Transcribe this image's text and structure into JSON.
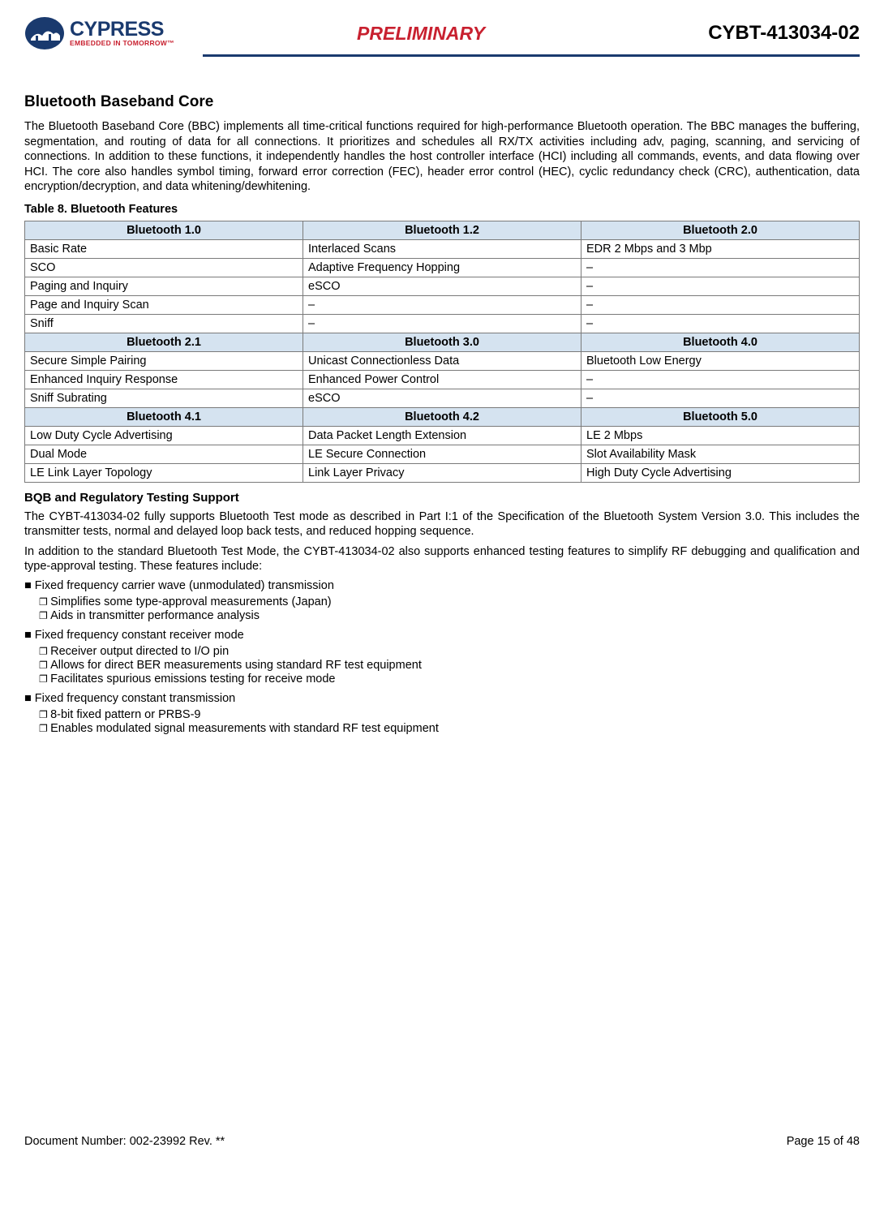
{
  "header": {
    "logo_main": "CYPRESS",
    "logo_tagline": "EMBEDDED IN TOMORROW™",
    "preliminary": "PRELIMINARY",
    "part": "CYBT-413034-02"
  },
  "section_title": "Bluetooth Baseband Core",
  "intro": "The Bluetooth Baseband Core (BBC) implements all time-critical functions required for high-performance Bluetooth operation. The BBC manages the buffering, segmentation, and routing of data for all connections. It prioritizes and schedules all RX/TX activities including adv, paging, scanning, and servicing of connections. In addition to these functions, it independently handles the host controller interface (HCI) including all commands, events, and data flowing over HCI. The core also handles symbol timing, forward error correction (FEC), header error control (HEC), cyclic redundancy check (CRC), authentication, data encryption/decryption, and data whitening/dewhitening.",
  "table_caption": "Table 8.  Bluetooth Features",
  "table": {
    "groups": [
      {
        "headers": [
          "Bluetooth 1.0",
          "Bluetooth 1.2",
          "Bluetooth 2.0"
        ],
        "rows": [
          [
            "Basic Rate",
            "Interlaced Scans",
            "EDR 2 Mbps and 3 Mbp"
          ],
          [
            "SCO",
            "Adaptive Frequency Hopping",
            "–"
          ],
          [
            "Paging and Inquiry",
            "eSCO",
            "–"
          ],
          [
            "Page and Inquiry Scan",
            "–",
            "–"
          ],
          [
            "Sniff",
            "–",
            "–"
          ]
        ]
      },
      {
        "headers": [
          "Bluetooth 2.1",
          "Bluetooth 3.0",
          "Bluetooth 4.0"
        ],
        "rows": [
          [
            "Secure Simple Pairing",
            "Unicast Connectionless Data",
            "Bluetooth Low Energy"
          ],
          [
            "Enhanced Inquiry Response",
            "Enhanced Power Control",
            "–"
          ],
          [
            "Sniff Subrating",
            "eSCO",
            "–"
          ]
        ]
      },
      {
        "headers": [
          "Bluetooth 4.1",
          "Bluetooth 4.2",
          "Bluetooth 5.0"
        ],
        "rows": [
          [
            "Low Duty Cycle Advertising",
            "Data Packet Length Extension",
            " LE 2 Mbps"
          ],
          [
            "Dual Mode",
            "LE Secure Connection",
            "Slot Availability Mask"
          ],
          [
            "LE Link Layer Topology",
            "Link Layer Privacy",
            "High Duty Cycle Advertising"
          ]
        ]
      }
    ]
  },
  "sub_title": "BQB and Regulatory Testing Support",
  "sub_p1": "The CYBT-413034-02 fully supports Bluetooth Test mode as described in Part I:1 of the Specification of the Bluetooth System Version 3.0. This includes the transmitter tests, normal and delayed loop back tests, and reduced hopping sequence.",
  "sub_p2": "In addition to the standard Bluetooth Test Mode, the CYBT-413034-02 also supports enhanced testing features to simplify RF debugging and qualification and type-approval testing. These features include:",
  "bullets": [
    {
      "text": "Fixed frequency carrier wave (unmodulated) transmission",
      "subs": [
        "Simplifies some type-approval measurements (Japan)",
        "Aids in transmitter performance analysis"
      ]
    },
    {
      "text": "Fixed frequency constant receiver mode",
      "subs": [
        "Receiver output directed to I/O pin",
        "Allows for direct BER measurements using standard RF test equipment",
        "Facilitates spurious emissions testing for receive mode"
      ]
    },
    {
      "text": "Fixed frequency constant transmission",
      "subs": [
        "8-bit fixed pattern or PRBS-9",
        "Enables modulated signal measurements with standard RF test equipment"
      ]
    }
  ],
  "footer": {
    "doc": "Document Number: 002-23992 Rev. **",
    "page": "Page 15 of 48"
  }
}
